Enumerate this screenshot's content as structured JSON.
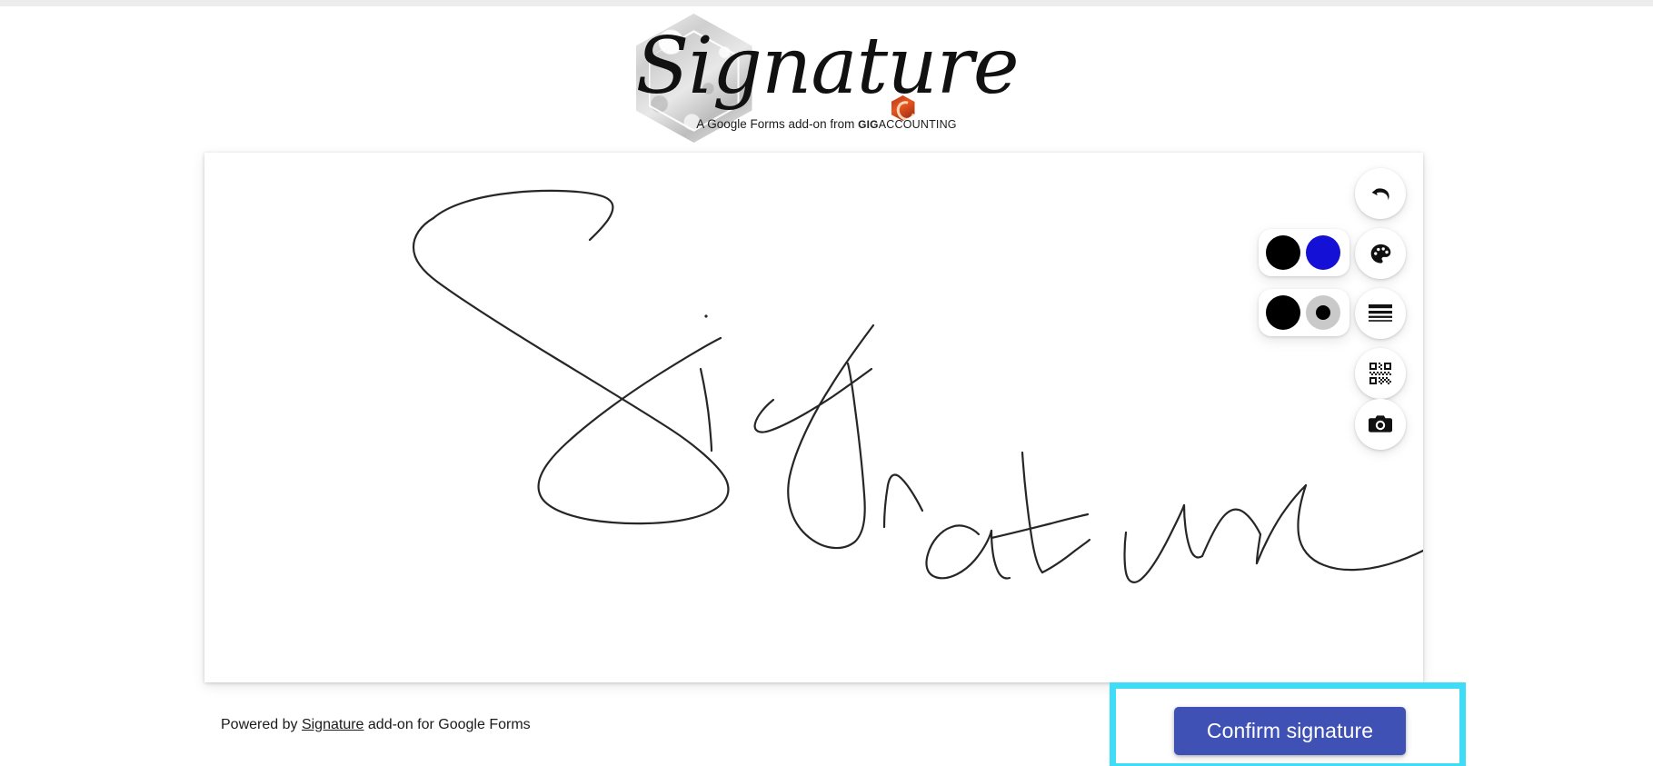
{
  "app": {
    "logo_text": "Signature",
    "tagline_prefix": "A Google Forms add-on from",
    "brand_gig": "GIG",
    "brand_accounting": "ACCOUNTING",
    "brand_badge_icon": "gig-hexagon-logo-icon"
  },
  "canvas": {
    "name": "signature-drawing-canvas",
    "drawn_text": "Signature",
    "stroke_color": "#262626",
    "stroke_width": 2.2,
    "background": "#ffffff"
  },
  "toolbar": {
    "undo": {
      "label": "Undo",
      "icon": "undo-arrow-icon"
    },
    "palette": {
      "label": "Pen color",
      "icon": "palette-icon"
    },
    "thickness": {
      "label": "Pen thickness",
      "icon": "line-thickness-icon"
    },
    "qr": {
      "label": "QR code",
      "icon": "qr-code-icon"
    },
    "camera": {
      "label": "Camera",
      "icon": "camera-icon"
    }
  },
  "color_panel": {
    "name": "color-swatch-panel",
    "options": [
      {
        "name": "color-swatch-black",
        "value": "#000000",
        "selected": true
      },
      {
        "name": "color-swatch-blue",
        "value": "#1410d6",
        "selected": false
      }
    ]
  },
  "thickness_panel": {
    "name": "thickness-option-panel",
    "options": [
      {
        "name": "thickness-option-thick",
        "bg": "#ffffff",
        "dot": "#000000",
        "dot_size": 38,
        "selected": true
      },
      {
        "name": "thickness-option-thin",
        "bg": "#c9c9c9",
        "dot": "#000000",
        "dot_size": 16,
        "selected": false
      }
    ]
  },
  "footer": {
    "prefix": "Powered by",
    "link": "Signature",
    "suffix": "add-on for Google Forms"
  },
  "actions": {
    "confirm_label": "Confirm signature",
    "confirm_color": "#3f51b5",
    "highlight_color": "#3fdcf7"
  },
  "colors": {
    "page_background": "#ffffff",
    "top_strip": "#ececec",
    "card_background": "#ffffff"
  }
}
